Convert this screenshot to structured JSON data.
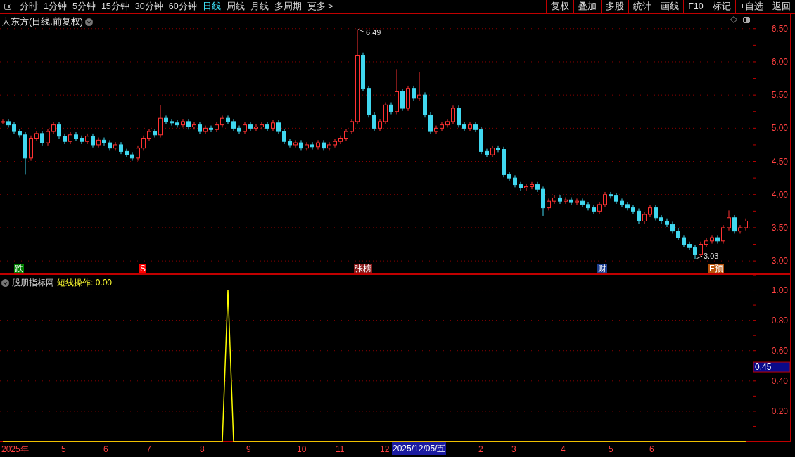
{
  "toolbar": {
    "periods": [
      {
        "label": "分时",
        "selected": false
      },
      {
        "label": "1分钟",
        "selected": false
      },
      {
        "label": "5分钟",
        "selected": false
      },
      {
        "label": "15分钟",
        "selected": false
      },
      {
        "label": "30分钟",
        "selected": false
      },
      {
        "label": "60分钟",
        "selected": false
      },
      {
        "label": "日线",
        "selected": true
      },
      {
        "label": "周线",
        "selected": false
      },
      {
        "label": "月线",
        "selected": false
      },
      {
        "label": "多周期",
        "selected": false
      },
      {
        "label": "更多 >",
        "selected": false
      }
    ],
    "actions": [
      "复权",
      "叠加",
      "多股",
      "统计",
      "画线",
      "F10",
      "标记",
      "+自选",
      "返回"
    ]
  },
  "main_panel": {
    "title": "大东方(日线.前复权)",
    "chart_data": {
      "type": "candlestick",
      "ylim": [
        2.8,
        6.72
      ],
      "grid": true,
      "yticks": [
        {
          "value": 3.0,
          "label": "3.00"
        },
        {
          "value": 3.5,
          "label": "3.50"
        },
        {
          "value": 4.0,
          "label": "4.00"
        },
        {
          "value": 4.5,
          "label": "4.50"
        },
        {
          "value": 5.0,
          "label": "5.00"
        },
        {
          "value": 5.5,
          "label": "5.50"
        },
        {
          "value": 6.0,
          "label": "6.00"
        },
        {
          "value": 6.5,
          "label": "6.50"
        }
      ],
      "ohlc": [
        [
          5.1,
          5.14,
          5.06,
          5.1
        ],
        [
          5.1,
          5.14,
          5.01,
          5.05
        ],
        [
          5.05,
          5.09,
          4.91,
          4.95
        ],
        [
          4.95,
          4.99,
          4.86,
          4.9
        ],
        [
          4.9,
          4.94,
          4.3,
          4.55
        ],
        [
          4.55,
          4.89,
          4.51,
          4.85
        ],
        [
          4.85,
          4.96,
          4.81,
          4.92
        ],
        [
          4.92,
          4.96,
          4.74,
          4.78
        ],
        [
          4.78,
          4.99,
          4.74,
          4.95
        ],
        [
          4.95,
          5.09,
          4.91,
          5.05
        ],
        [
          5.05,
          5.09,
          4.84,
          4.88
        ],
        [
          4.88,
          4.92,
          4.76,
          4.8
        ],
        [
          4.8,
          4.94,
          4.76,
          4.9
        ],
        [
          4.9,
          4.94,
          4.81,
          4.85
        ],
        [
          4.85,
          4.89,
          4.76,
          4.8
        ],
        [
          4.8,
          4.92,
          4.76,
          4.88
        ],
        [
          4.88,
          4.92,
          4.71,
          4.75
        ],
        [
          4.75,
          4.86,
          4.71,
          4.82
        ],
        [
          4.82,
          4.86,
          4.74,
          4.78
        ],
        [
          4.78,
          4.82,
          4.66,
          4.7
        ],
        [
          4.7,
          4.79,
          4.66,
          4.75
        ],
        [
          4.75,
          4.79,
          4.61,
          4.65
        ],
        [
          4.65,
          4.69,
          4.56,
          4.6
        ],
        [
          4.6,
          4.64,
          4.51,
          4.55
        ],
        [
          4.55,
          4.74,
          4.51,
          4.7
        ],
        [
          4.7,
          4.89,
          4.66,
          4.85
        ],
        [
          4.85,
          4.99,
          4.81,
          4.95
        ],
        [
          4.95,
          4.99,
          4.86,
          4.9
        ],
        [
          4.9,
          5.35,
          4.86,
          5.15
        ],
        [
          5.15,
          5.19,
          5.06,
          5.1
        ],
        [
          5.1,
          5.14,
          5.04,
          5.08
        ],
        [
          5.08,
          5.12,
          5.01,
          5.05
        ],
        [
          5.05,
          5.14,
          5.01,
          5.1
        ],
        [
          5.1,
          5.14,
          4.98,
          5.02
        ],
        [
          5.02,
          5.09,
          4.98,
          5.05
        ],
        [
          5.05,
          5.09,
          4.91,
          4.95
        ],
        [
          4.95,
          5.04,
          4.91,
          5.0
        ],
        [
          5.0,
          5.04,
          4.94,
          4.98
        ],
        [
          4.98,
          5.09,
          4.94,
          5.05
        ],
        [
          5.05,
          5.19,
          5.01,
          5.15
        ],
        [
          5.15,
          5.19,
          5.06,
          5.1
        ],
        [
          5.1,
          5.14,
          4.96,
          5.0
        ],
        [
          5.0,
          5.04,
          4.91,
          4.95
        ],
        [
          4.95,
          5.09,
          4.91,
          5.05
        ],
        [
          5.05,
          5.09,
          4.96,
          5.0
        ],
        [
          5.0,
          5.06,
          4.96,
          5.02
        ],
        [
          5.02,
          5.09,
          4.98,
          5.05
        ],
        [
          5.05,
          5.09,
          4.96,
          5.0
        ],
        [
          5.0,
          5.12,
          4.96,
          5.08
        ],
        [
          5.08,
          5.12,
          4.91,
          4.95
        ],
        [
          4.95,
          4.99,
          4.76,
          4.8
        ],
        [
          4.8,
          4.84,
          4.71,
          4.75
        ],
        [
          4.75,
          4.82,
          4.71,
          4.78
        ],
        [
          4.78,
          4.82,
          4.66,
          4.7
        ],
        [
          4.7,
          4.79,
          4.66,
          4.75
        ],
        [
          4.75,
          4.79,
          4.68,
          4.72
        ],
        [
          4.72,
          4.82,
          4.68,
          4.78
        ],
        [
          4.78,
          4.82,
          4.66,
          4.7
        ],
        [
          4.7,
          4.79,
          4.66,
          4.75
        ],
        [
          4.75,
          4.84,
          4.71,
          4.8
        ],
        [
          4.8,
          4.89,
          4.76,
          4.85
        ],
        [
          4.85,
          4.99,
          4.81,
          4.95
        ],
        [
          4.95,
          5.14,
          4.91,
          5.1
        ],
        [
          5.1,
          6.49,
          5.06,
          6.1
        ],
        [
          6.1,
          6.14,
          5.56,
          5.6
        ],
        [
          5.6,
          5.64,
          5.16,
          5.2
        ],
        [
          5.2,
          5.24,
          4.96,
          5.0
        ],
        [
          5.0,
          5.14,
          4.96,
          5.1
        ],
        [
          5.1,
          5.39,
          5.06,
          5.35
        ],
        [
          5.35,
          5.39,
          5.21,
          5.25
        ],
        [
          5.25,
          5.89,
          5.21,
          5.55
        ],
        [
          5.55,
          5.59,
          5.26,
          5.3
        ],
        [
          5.3,
          5.64,
          5.26,
          5.6
        ],
        [
          5.6,
          5.64,
          5.41,
          5.45
        ],
        [
          5.45,
          5.85,
          5.41,
          5.5
        ],
        [
          5.5,
          5.54,
          5.16,
          5.2
        ],
        [
          5.2,
          5.24,
          4.91,
          4.95
        ],
        [
          4.95,
          5.04,
          4.91,
          5.0
        ],
        [
          5.0,
          5.09,
          4.96,
          5.05
        ],
        [
          5.05,
          5.14,
          5.01,
          5.1
        ],
        [
          5.1,
          5.34,
          5.06,
          5.3
        ],
        [
          5.3,
          5.34,
          5.01,
          5.05
        ],
        [
          5.05,
          5.09,
          4.96,
          5.0
        ],
        [
          5.0,
          5.09,
          4.96,
          5.05
        ],
        [
          5.05,
          5.09,
          4.94,
          4.98
        ],
        [
          4.98,
          5.02,
          4.61,
          4.65
        ],
        [
          4.65,
          4.69,
          4.56,
          4.6
        ],
        [
          4.6,
          4.74,
          4.56,
          4.7
        ],
        [
          4.7,
          4.74,
          4.64,
          4.68
        ],
        [
          4.68,
          4.72,
          4.26,
          4.3
        ],
        [
          4.3,
          4.34,
          4.21,
          4.25
        ],
        [
          4.25,
          4.29,
          4.11,
          4.15
        ],
        [
          4.15,
          4.19,
          4.06,
          4.1
        ],
        [
          4.1,
          4.16,
          4.06,
          4.12
        ],
        [
          4.12,
          4.19,
          4.08,
          4.15
        ],
        [
          4.15,
          4.19,
          4.04,
          4.08
        ],
        [
          4.08,
          4.12,
          3.68,
          3.8
        ],
        [
          3.8,
          3.94,
          3.76,
          3.9
        ],
        [
          3.9,
          3.99,
          3.86,
          3.95
        ],
        [
          3.95,
          3.99,
          3.86,
          3.9
        ],
        [
          3.9,
          3.96,
          3.86,
          3.92
        ],
        [
          3.92,
          3.96,
          3.84,
          3.88
        ],
        [
          3.88,
          3.94,
          3.84,
          3.9
        ],
        [
          3.9,
          3.94,
          3.81,
          3.85
        ],
        [
          3.85,
          3.89,
          3.76,
          3.8
        ],
        [
          3.8,
          3.84,
          3.71,
          3.75
        ],
        [
          3.75,
          3.89,
          3.71,
          3.85
        ],
        [
          3.85,
          4.04,
          3.81,
          4.0
        ],
        [
          4.0,
          4.04,
          3.94,
          3.98
        ],
        [
          3.98,
          4.02,
          3.86,
          3.9
        ],
        [
          3.9,
          3.94,
          3.81,
          3.85
        ],
        [
          3.85,
          3.89,
          3.76,
          3.8
        ],
        [
          3.8,
          3.84,
          3.71,
          3.75
        ],
        [
          3.75,
          3.79,
          3.56,
          3.6
        ],
        [
          3.6,
          3.74,
          3.56,
          3.7
        ],
        [
          3.7,
          3.84,
          3.66,
          3.8
        ],
        [
          3.8,
          3.84,
          3.61,
          3.65
        ],
        [
          3.65,
          3.69,
          3.56,
          3.6
        ],
        [
          3.6,
          3.64,
          3.51,
          3.55
        ],
        [
          3.55,
          3.59,
          3.41,
          3.45
        ],
        [
          3.45,
          3.49,
          3.31,
          3.35
        ],
        [
          3.35,
          3.39,
          3.21,
          3.25
        ],
        [
          3.25,
          3.29,
          3.16,
          3.2
        ],
        [
          3.2,
          3.24,
          3.03,
          3.1
        ],
        [
          3.1,
          3.29,
          3.06,
          3.25
        ],
        [
          3.25,
          3.34,
          3.21,
          3.3
        ],
        [
          3.3,
          3.39,
          3.26,
          3.35
        ],
        [
          3.35,
          3.39,
          3.26,
          3.3
        ],
        [
          3.3,
          3.54,
          3.26,
          3.5
        ],
        [
          3.5,
          3.76,
          3.46,
          3.65
        ],
        [
          3.65,
          3.69,
          3.41,
          3.45
        ],
        [
          3.45,
          3.54,
          3.41,
          3.5
        ],
        [
          3.5,
          3.64,
          3.46,
          3.6
        ]
      ]
    },
    "price_markers": [
      {
        "kind": "high",
        "label": "6.49"
      },
      {
        "kind": "low",
        "label": "3.03"
      }
    ],
    "badges": [
      {
        "label": "跌",
        "color": "#008000"
      },
      {
        "label": "S",
        "color": "#ff0000"
      },
      {
        "label": "张榜",
        "color": "#8b1a1a"
      },
      {
        "label": "财",
        "color": "#1e3f8f"
      },
      {
        "label": "E预",
        "color": "#b8530b"
      }
    ]
  },
  "indicator_panel": {
    "name": "股朋指标网",
    "reading": "短线操作: 0.00",
    "cursor_value": "0.45",
    "chart_data": {
      "type": "line",
      "ylim": [
        0,
        1.1
      ],
      "grid": true,
      "yticks": [
        {
          "value": 0.2,
          "label": "0.20"
        },
        {
          "value": 0.4,
          "label": "0.40"
        },
        {
          "value": 0.6,
          "label": "0.60"
        },
        {
          "value": 0.8,
          "label": "0.80"
        },
        {
          "value": 1.0,
          "label": "1.00"
        }
      ],
      "series": [
        {
          "color": "#ffff00",
          "values": [
            0,
            0,
            0,
            0,
            0,
            0,
            0,
            0,
            0,
            0,
            0,
            0,
            0,
            0,
            0,
            0,
            0,
            0,
            0,
            0,
            0,
            0,
            0,
            0,
            0,
            0,
            0,
            0,
            0,
            0,
            0,
            0,
            0,
            0,
            0,
            0,
            0,
            0,
            0,
            0,
            1,
            0,
            0,
            0,
            0,
            0,
            0,
            0,
            0,
            0,
            0,
            0,
            0,
            0,
            0,
            0,
            0,
            0,
            0,
            0,
            0,
            0,
            0,
            0,
            0,
            0,
            0,
            0,
            0,
            0,
            0,
            0,
            0,
            0,
            0,
            0,
            0,
            0,
            0,
            0,
            0,
            0,
            0,
            0,
            0,
            0,
            0,
            0,
            0,
            0,
            0,
            0,
            0,
            0,
            0,
            0,
            0,
            0,
            0,
            0,
            0,
            0,
            0,
            0,
            0,
            0,
            0,
            0,
            0,
            0,
            0,
            0,
            0,
            0,
            0,
            0,
            0,
            0,
            0,
            0,
            0,
            0,
            0,
            0,
            0,
            0,
            0,
            0,
            0,
            0,
            0,
            0,
            0
          ]
        }
      ]
    }
  },
  "date_axis": {
    "labels": [
      "2025年",
      "5",
      "6",
      "7",
      "8",
      "9",
      "10",
      "11",
      "12",
      "2",
      "3",
      "4",
      "5",
      "6"
    ],
    "cursor_label": "2025/12/05/五"
  }
}
